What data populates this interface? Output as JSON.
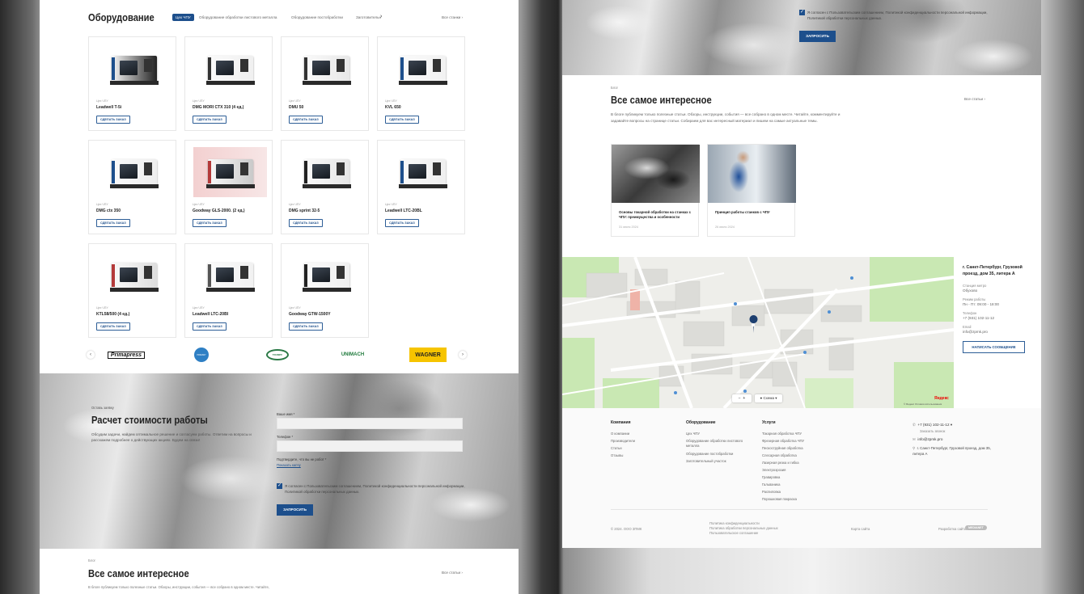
{
  "colors": {
    "accent": "#1d4f8c",
    "map_green": "#c9e8b3"
  },
  "left": {
    "equipment": {
      "title": "Оборудование",
      "tabs": [
        {
          "label": "Цех ЧПУ",
          "active": true
        },
        {
          "label": "Оборудование обработки листового металла"
        },
        {
          "label": "Оборудование постобработки"
        },
        {
          "label": "Заготовительн"
        }
      ],
      "all_link": "Все станки",
      "cards": [
        {
          "category": "Цех ЧПУ",
          "name": "Leadwell T-5i",
          "button": "сделать заказ"
        },
        {
          "category": "Цех ЧПУ",
          "name": "DMG MORI CTX 310 (4 ед.)",
          "button": "сделать заказ"
        },
        {
          "category": "Цех ЧПУ",
          "name": "DMU 50",
          "button": "сделать заказ"
        },
        {
          "category": "Цех ЧПУ",
          "name": "KVL 650",
          "button": "сделать заказ"
        },
        {
          "category": "Цех ЧПУ",
          "name": "DMG ctx 350",
          "button": "сделать заказ"
        },
        {
          "category": "Цех ЧПУ",
          "name": "Goodway GLS-2000. (2 ед.)",
          "button": "сделать заказ"
        },
        {
          "category": "Цех ЧПУ",
          "name": "DMG sprint 32-5",
          "button": "сделать заказ"
        },
        {
          "category": "Цех ЧПУ",
          "name": "Leadwell LTC-20BL",
          "button": "сделать заказ"
        },
        {
          "category": "Цех ЧПУ",
          "name": "KTL58/500 (4 ед.)",
          "button": "сделать заказ"
        },
        {
          "category": "Цех ЧПУ",
          "name": "Leadwell LTC-20BI",
          "button": "сделать заказ"
        },
        {
          "category": "Цех ЧПУ",
          "name": "Goodway GTW-1500Y",
          "button": "сделать заказ"
        }
      ],
      "brands": [
        "Primapress",
        "PRIMARY",
        "TRUMPF",
        "UNIMACH",
        "WAGNER"
      ]
    },
    "calc": {
      "eyebrow": "Оставь заявку",
      "title": "Расчет стоимости работы",
      "text": "Обсудим задачи, найдем оптимальное решение и согласуем работы. Ответим на вопросы и расскажем подробнее о действующих акциях. Будем на связи!",
      "name_label": "Ваше имя *",
      "phone_label": "Телефон *",
      "robot_label": "Подтвердите, что вы не робот *",
      "captcha_link": "Показать капчу",
      "consent": "Я согласен с Пользовательским соглашением, Политикой конфиденциальности персональной информации, Политикой обработки персональных данных.",
      "submit": "Запросить"
    },
    "blog": {
      "eyebrow": "Блог",
      "title": "Все самое интересное",
      "all_link": "Все статьи",
      "text": "В блоге публикуем только полезные статьи. Обзоры, инструкции, события — все собрано в одном месте. Читайте,"
    }
  },
  "right": {
    "consent": "Я согласен с Пользовательским соглашением, Политикой конфиденциальности персональной информации, Политикой обработки персональных данных.",
    "submit": "Запросить",
    "blog": {
      "eyebrow": "Блог",
      "title": "Все самое интересное",
      "all_link": "Все статьи",
      "text": "В блоге публикуем только полезные статьи. Обзоры, инструкции, события — все собрано в одном месте. Читайте, комментируйте и задавайте вопросы на странице статьи. Собираем для вас интересный материал и пишем на самые актуальные темы.",
      "posts": [
        {
          "title": "Основы токарной обработки на станках с ЧПУ: преимущества и особенности",
          "date": "31 июля 2024"
        },
        {
          "title": "Принцип работы станков с ЧПУ",
          "date": "26 июля 2024"
        }
      ]
    },
    "contact": {
      "address": "г. Санкт-Петербург, Грузовой проезд, дом 35, литера А",
      "metro_label": "Станция метро",
      "metro": "Обухово",
      "hours_label": "Режим работы",
      "hours": "Пн - Пт: 09:00 - 18:00",
      "phone_label": "Телефон",
      "phone": "+7 (931) 102-11-12",
      "email_label": "Email",
      "email": "info@zpmk.pro",
      "button": "Написать сообщение"
    },
    "map": {
      "scheme": "Схема",
      "brand": "Яндекс",
      "terms": "© Яндекс Условия использования",
      "zoom_in": "+",
      "zoom_out": "−"
    },
    "footer": {
      "cols": [
        {
          "title": "Компания",
          "items": [
            "О компании",
            "Производители",
            "Статьи",
            "Отзывы"
          ]
        },
        {
          "title": "Оборудование",
          "items": [
            "Цех ЧПУ",
            "Оборудование обработки листового металла",
            "Оборудование постобработки",
            "Заготовительный участок"
          ]
        },
        {
          "title": "Услуги",
          "items": [
            "Токарная обработка ЧПУ",
            "Фрезерная обработка ЧПУ",
            "Пескоструйная обработка",
            "Слесарная обработка",
            "Лазерная резка и гибка",
            "Электроэрозия",
            "Гравировка",
            "Гальваника",
            "Распиловка",
            "Порошковая покраска"
          ]
        }
      ],
      "phone": "+7 (931) 102-11-12",
      "callback": "Заказать звонок",
      "email": "info@zpmk.pro",
      "address": "г. Санкт-Петербург, Грузовой проезд, дом 35, литера А",
      "copyright": "© 2024. ООО ЗПМК",
      "policies": [
        "Политика конфиденциальности",
        "Политика обработки персональных данных",
        "Пользовательское соглашение"
      ],
      "sitemap": "Карта сайта",
      "made": "Разработка сайта",
      "dev": "MEDIANET"
    }
  }
}
